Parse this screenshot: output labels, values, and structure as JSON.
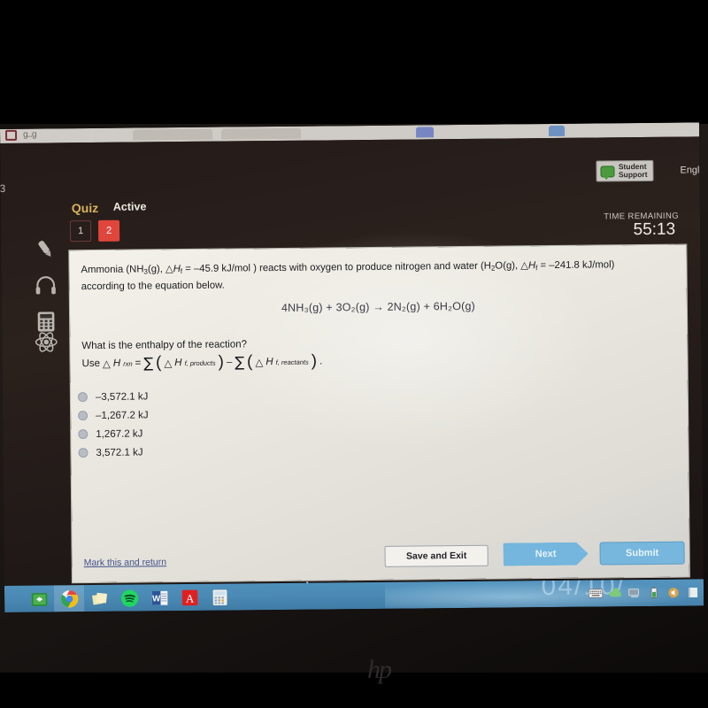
{
  "device": {
    "brand_logo": "hp"
  },
  "browser": {
    "tab_hint": "g...g"
  },
  "app_header": {
    "quiz_label": "Quiz",
    "status_label": "Active",
    "support_button": "Student\nSupport",
    "support_line1": "Student",
    "support_line2": "Support",
    "language": "Engl",
    "edge_letter": "3",
    "time_label": "TIME REMAINING",
    "time_value": "55:13"
  },
  "question_chips": [
    {
      "label": "1",
      "state": "unanswered"
    },
    {
      "label": "2",
      "state": "current"
    }
  ],
  "tool_rail": [
    {
      "icon": "highlighter-icon",
      "name": "highlighter"
    },
    {
      "icon": "headphones-icon",
      "name": "audio"
    },
    {
      "icon": "calculator-icon",
      "name": "calculator"
    },
    {
      "icon": "atom-icon",
      "name": "periodic-table"
    }
  ],
  "question": {
    "body_part1": "Ammonia (NH",
    "body_nh3_sub": "3",
    "body_part2": "(g), ",
    "delta": "△",
    "h_symbol": "H",
    "f_sub": "f",
    "value1": " = –45.9 kJ/mol ) reacts with oxygen to produce nitrogen and water (H",
    "h2o_sub": "2",
    "body_part3": "O(g), ",
    "value2": " = –241.8 kJ/mol)",
    "body_line2": "according to the equation below.",
    "equation": "4NH₃(g) + 3O₂(g) → 2N₂(g) + 6H₂O(g)",
    "prompt": "What is the enthalpy of the reaction?",
    "formula_use": "Use",
    "formula_rxn_sub": "rxn",
    "formula_sigma": "∑",
    "formula_products": "f, products",
    "formula_minus": "–",
    "formula_reactants": "f, reactants"
  },
  "options": [
    {
      "label": "–3,572.1 kJ",
      "selected": false
    },
    {
      "label": "–1,267.2 kJ",
      "selected": false
    },
    {
      "label": "1,267.2 kJ",
      "selected": false
    },
    {
      "label": "3,572.1 kJ",
      "selected": false
    }
  ],
  "footer": {
    "mark_link": "Mark this and return",
    "save_button": "Save and Exit",
    "next_button": "Next",
    "submit_button": "Submit"
  },
  "taskbar": {
    "items": [
      {
        "name": "microsoft-store",
        "icon": "store-icon"
      },
      {
        "name": "google-chrome",
        "icon": "chrome-icon"
      },
      {
        "name": "sticky-notes",
        "icon": "sticky-notes-icon"
      },
      {
        "name": "spotify",
        "icon": "spotify-icon"
      },
      {
        "name": "microsoft-word",
        "icon": "word-icon"
      },
      {
        "name": "adobe-acrobat",
        "icon": "acrobat-icon"
      },
      {
        "name": "calculator",
        "icon": "calculator-app-icon"
      }
    ],
    "tray": [
      {
        "name": "keyboard",
        "icon": "keyboard-icon"
      },
      {
        "name": "onedrive",
        "icon": "onedrive-icon"
      },
      {
        "name": "network",
        "icon": "network-icon"
      },
      {
        "name": "battery",
        "icon": "battery-icon"
      },
      {
        "name": "volume",
        "icon": "volume-icon"
      },
      {
        "name": "notification",
        "icon": "bell-icon"
      }
    ],
    "wallpaper_text": "04/10/"
  },
  "colors": {
    "accent_red": "#e0463c",
    "accent_gold": "#d8b25e",
    "button_blue": "#74b6dd",
    "link_blue": "#44528c",
    "taskbar_blue": "#4a89b4"
  }
}
